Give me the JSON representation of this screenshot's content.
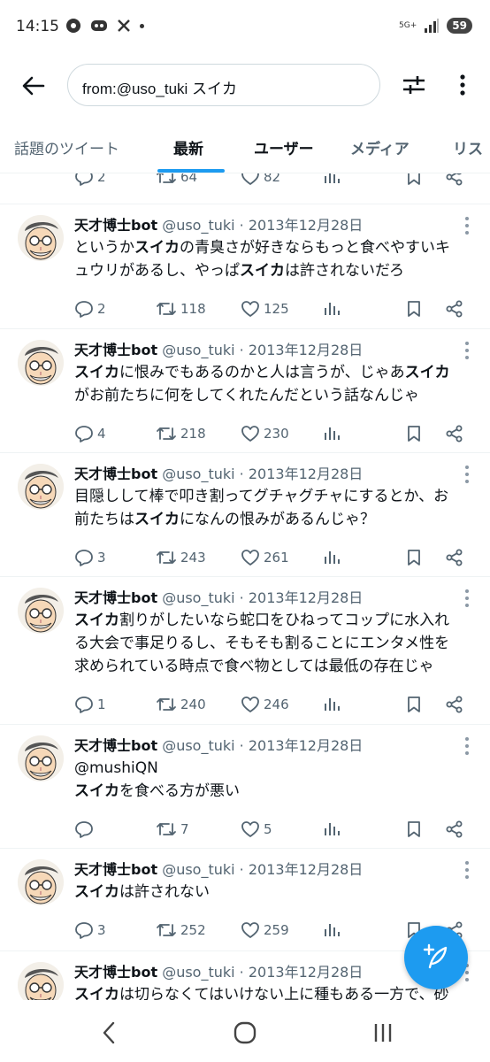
{
  "status_bar": {
    "time": "14:15",
    "battery": "59",
    "network": "5G+",
    "icons_left": [
      "threads-icon",
      "discord-icon",
      "x-logo-icon",
      "dot-icon"
    ]
  },
  "header": {
    "search_value": "from:@uso_tuki スイカ"
  },
  "tabs": [
    {
      "label": "話題のツイート",
      "active": false
    },
    {
      "label": "最新",
      "active": true
    },
    {
      "label": "ユーザー",
      "active": false
    },
    {
      "label": "メディア",
      "active": false
    },
    {
      "label": "リス",
      "active": false
    }
  ],
  "top_partial": {
    "replies": "2",
    "retweets": "64",
    "likes": "82"
  },
  "tweets": [
    {
      "name": "天才博士bot",
      "handle": "@uso_tuki",
      "date": "2013年12月28日",
      "lines": [
        [
          [
            "というか",
            false
          ],
          [
            "スイカ",
            true
          ],
          [
            "の青臭さが好きならもっと食べやすいキ",
            false
          ]
        ],
        [
          [
            "ュウリがあるし、やっぱ",
            false
          ],
          [
            "スイカ",
            true
          ],
          [
            "は許されないだろ",
            false
          ]
        ]
      ],
      "replies": "2",
      "retweets": "118",
      "likes": "125"
    },
    {
      "name": "天才博士bot",
      "handle": "@uso_tuki",
      "date": "2013年12月28日",
      "lines": [
        [
          [
            "スイカ",
            true
          ],
          [
            "に恨みでもあるのかと人は言うが、じゃあ",
            false
          ],
          [
            "スイカ",
            true
          ]
        ],
        [
          [
            "がお前たちに何をしてくれたんだという話なんじゃ",
            false
          ]
        ]
      ],
      "replies": "4",
      "retweets": "218",
      "likes": "230"
    },
    {
      "name": "天才博士bot",
      "handle": "@uso_tuki",
      "date": "2013年12月28日",
      "lines": [
        [
          [
            "目隠しして棒で叩き割ってグチャグチャにするとか、お",
            false
          ]
        ],
        [
          [
            "前たちは",
            false
          ],
          [
            "スイカ",
            true
          ],
          [
            "になんの恨みがあるんじゃ？",
            false
          ]
        ]
      ],
      "replies": "3",
      "retweets": "243",
      "likes": "261"
    },
    {
      "name": "天才博士bot",
      "handle": "@uso_tuki",
      "date": "2013年12月28日",
      "lines": [
        [
          [
            "スイカ",
            true
          ],
          [
            "割りがしたいなら蛇口をひねってコップに水入れ",
            false
          ]
        ],
        [
          [
            "る大会で事足りるし、そもそも割ることにエンタメ性を",
            false
          ]
        ],
        [
          [
            "求められている時点で食べ物としては最低の存在じゃ",
            false
          ]
        ]
      ],
      "replies": "1",
      "retweets": "240",
      "likes": "246"
    },
    {
      "name": "天才博士bot",
      "handle": "@uso_tuki",
      "date": "2013年12月28日",
      "lines": [
        [
          [
            "@mushiQN",
            false
          ]
        ],
        [
          [
            "スイカ",
            true
          ],
          [
            "を食べる方が悪い",
            false
          ]
        ]
      ],
      "replies": "",
      "retweets": "7",
      "likes": "5"
    },
    {
      "name": "天才博士bot",
      "handle": "@uso_tuki",
      "date": "2013年12月28日",
      "lines": [
        [
          [
            "スイカ",
            true
          ],
          [
            "は許されない",
            false
          ]
        ]
      ],
      "replies": "3",
      "retweets": "252",
      "likes": "259"
    },
    {
      "name": "天才博士bot",
      "handle": "@uso_tuki",
      "date": "2013年12月28日",
      "lines": [
        [
          [
            "スイカ",
            true
          ],
          [
            "は切らなくてはいけない上に種もある一方で、砂",
            false
          ]
        ]
      ],
      "replies": "",
      "retweets": "",
      "likes": ""
    }
  ],
  "colors": {
    "accent": "#1d9bf0",
    "muted": "#536471",
    "text": "#0f1419"
  }
}
